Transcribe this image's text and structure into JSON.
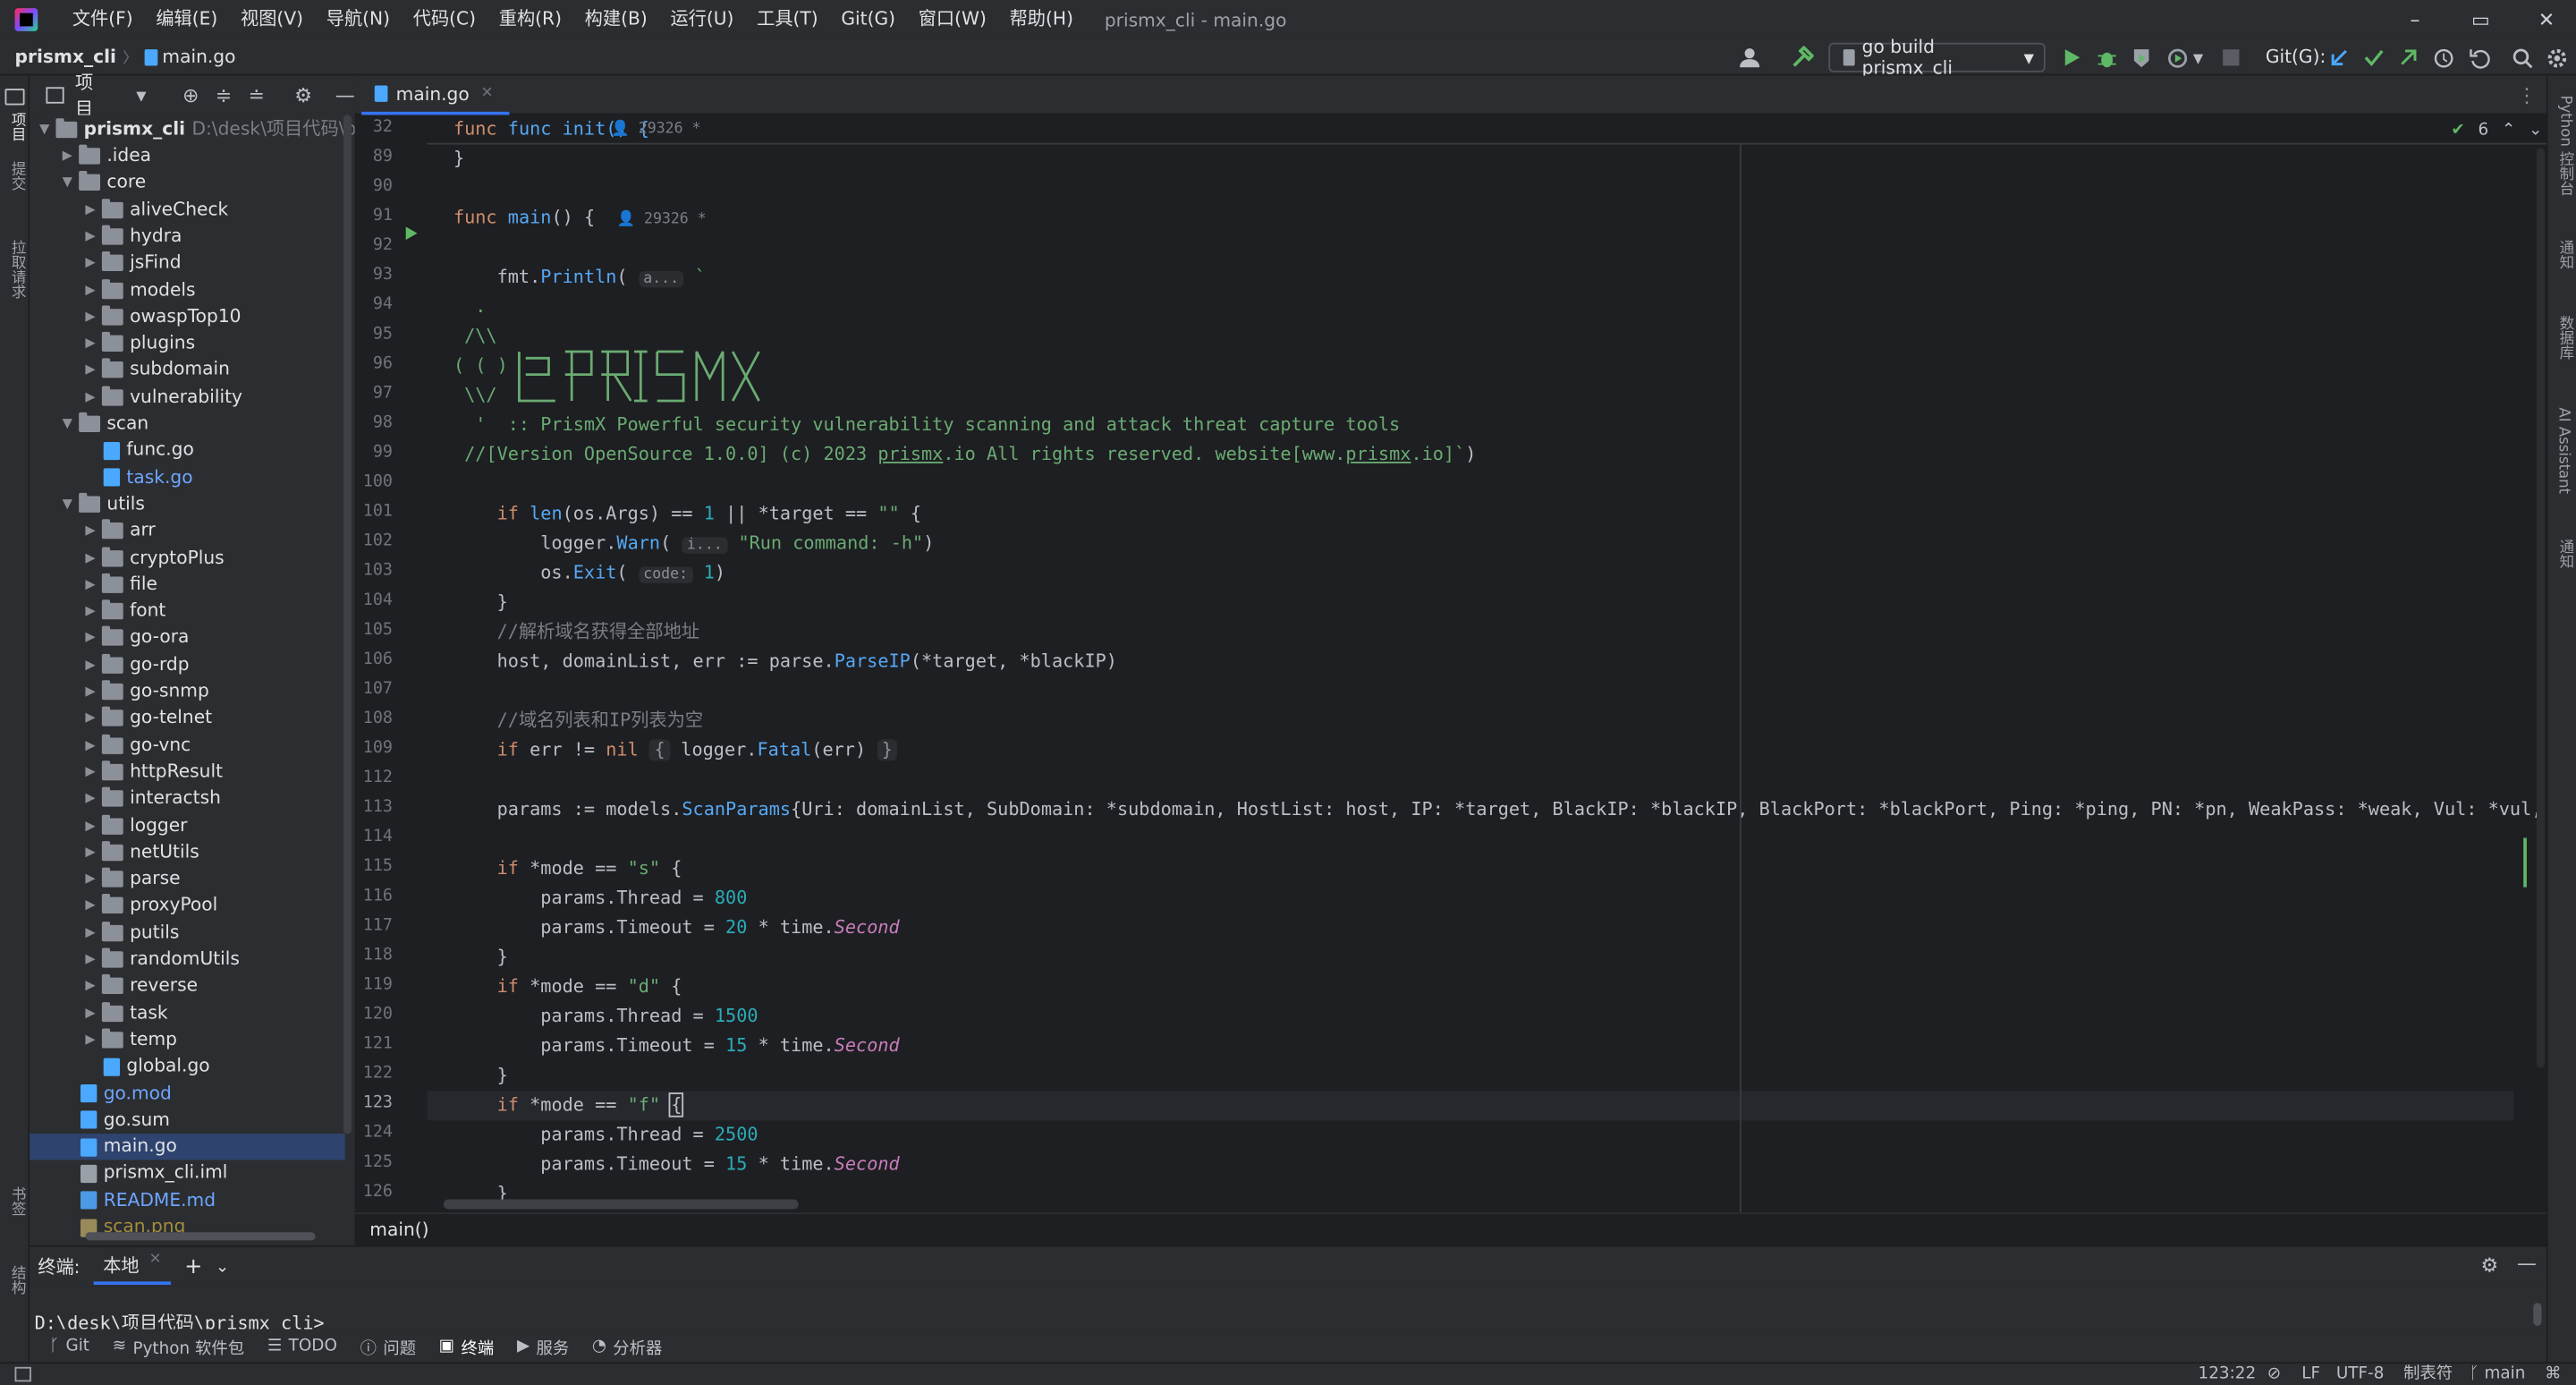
{
  "window": {
    "title": "prismx_cli - main.go",
    "minimize": "–",
    "restore": "▭",
    "close": "✕"
  },
  "menu": [
    "文件(F)",
    "编辑(E)",
    "视图(V)",
    "导航(N)",
    "代码(C)",
    "重构(R)",
    "构建(B)",
    "运行(U)",
    "工具(T)",
    "Git(G)",
    "窗口(W)",
    "帮助(H)"
  ],
  "nav": {
    "project": "prismx_cli",
    "file": "main.go",
    "run_config": "go build prismx_cli",
    "git_label": "Git(G):"
  },
  "left_strip": [
    "项目",
    "提交",
    "拉取请求",
    "书签",
    "结构"
  ],
  "right_strip": [
    "Python 控制台",
    "通知",
    "数据库",
    "AI Assistant",
    "通知"
  ],
  "project_panel": {
    "title": "项目",
    "root_name": "prismx_cli",
    "root_path": "D:\\desk\\项目代码\\prism",
    "tree": [
      {
        "depth": 1,
        "type": "folder",
        "open": false,
        "name": ".idea"
      },
      {
        "depth": 1,
        "type": "folder",
        "open": true,
        "name": "core"
      },
      {
        "depth": 2,
        "type": "folder",
        "open": false,
        "name": "aliveCheck"
      },
      {
        "depth": 2,
        "type": "folder",
        "open": false,
        "name": "hydra"
      },
      {
        "depth": 2,
        "type": "folder",
        "open": false,
        "name": "jsFind"
      },
      {
        "depth": 2,
        "type": "folder",
        "open": false,
        "name": "models"
      },
      {
        "depth": 2,
        "type": "folder",
        "open": false,
        "name": "owaspTop10"
      },
      {
        "depth": 2,
        "type": "folder",
        "open": false,
        "name": "plugins"
      },
      {
        "depth": 2,
        "type": "folder",
        "open": false,
        "name": "subdomain"
      },
      {
        "depth": 2,
        "type": "folder",
        "open": false,
        "name": "vulnerability"
      },
      {
        "depth": 1,
        "type": "folder",
        "open": true,
        "name": "scan"
      },
      {
        "depth": 2,
        "type": "go",
        "name": "func.go"
      },
      {
        "depth": 2,
        "type": "go",
        "name": "task.go",
        "color": "#6ea5ff"
      },
      {
        "depth": 1,
        "type": "folder",
        "open": true,
        "name": "utils"
      },
      {
        "depth": 2,
        "type": "folder",
        "open": false,
        "name": "arr"
      },
      {
        "depth": 2,
        "type": "folder",
        "open": false,
        "name": "cryptoPlus"
      },
      {
        "depth": 2,
        "type": "folder",
        "open": false,
        "name": "file"
      },
      {
        "depth": 2,
        "type": "folder",
        "open": false,
        "name": "font"
      },
      {
        "depth": 2,
        "type": "folder",
        "open": false,
        "name": "go-ora"
      },
      {
        "depth": 2,
        "type": "folder",
        "open": false,
        "name": "go-rdp"
      },
      {
        "depth": 2,
        "type": "folder",
        "open": false,
        "name": "go-snmp"
      },
      {
        "depth": 2,
        "type": "folder",
        "open": false,
        "name": "go-telnet"
      },
      {
        "depth": 2,
        "type": "folder",
        "open": false,
        "name": "go-vnc"
      },
      {
        "depth": 2,
        "type": "folder",
        "open": false,
        "name": "httpResult"
      },
      {
        "depth": 2,
        "type": "folder",
        "open": false,
        "name": "interactsh"
      },
      {
        "depth": 2,
        "type": "folder",
        "open": false,
        "name": "logger"
      },
      {
        "depth": 2,
        "type": "folder",
        "open": false,
        "name": "netUtils"
      },
      {
        "depth": 2,
        "type": "folder",
        "open": false,
        "name": "parse"
      },
      {
        "depth": 2,
        "type": "folder",
        "open": false,
        "name": "proxyPool"
      },
      {
        "depth": 2,
        "type": "folder",
        "open": false,
        "name": "putils"
      },
      {
        "depth": 2,
        "type": "folder",
        "open": false,
        "name": "randomUtils"
      },
      {
        "depth": 2,
        "type": "folder",
        "open": false,
        "name": "reverse"
      },
      {
        "depth": 2,
        "type": "folder",
        "open": false,
        "name": "task"
      },
      {
        "depth": 2,
        "type": "folder",
        "open": false,
        "name": "temp"
      },
      {
        "depth": 2,
        "type": "go",
        "name": "global.go"
      },
      {
        "depth": 1,
        "type": "go",
        "name": "go.mod",
        "color": "#6ea5ff"
      },
      {
        "depth": 1,
        "type": "go",
        "name": "go.sum"
      },
      {
        "depth": 1,
        "type": "go",
        "name": "main.go",
        "selected": true
      },
      {
        "depth": 1,
        "type": "iml",
        "name": "prismx_cli.iml"
      },
      {
        "depth": 1,
        "type": "md",
        "name": "README.md",
        "color": "#6ea5ff"
      },
      {
        "depth": 1,
        "type": "png",
        "name": "scan.png",
        "color": "#a38c3e"
      }
    ]
  },
  "editor": {
    "tab": "main.go",
    "inspection_count": "6",
    "breadcrumb": "main()",
    "sticky_line": "32",
    "sticky_text": "func init() {",
    "sticky_author": "29326 *",
    "lines": [
      {
        "n": "89",
        "html": "<span>}</span>"
      },
      {
        "n": "90",
        "html": ""
      },
      {
        "n": "91",
        "html": "<span class=\"kw\">func</span> <span class=\"fn\">main</span>() {  <span class=\"cm\" style=\"font-size:9px\">👤 29326 *</span>"
      },
      {
        "n": "92",
        "html": ""
      },
      {
        "n": "93",
        "html": "    fmt.<span class=\"fn\">Println</span>( <span class=\"hint\">a...</span> <span class=\"str\">`</span>"
      },
      {
        "n": "94",
        "html": "<span class=\"str\">  .</span>"
      },
      {
        "n": "95",
        "html": "<span class=\"str\"> /\\\\</span>"
      },
      {
        "n": "96",
        "html": "<span class=\"str\">( ( )</span>"
      },
      {
        "n": "97",
        "html": "<span class=\"str\"> \\\\/</span>"
      },
      {
        "n": "98",
        "html": "<span class=\"str\">  '  :: PrismX Powerful security vulnerability scanning and attack threat capture tools</span>"
      },
      {
        "n": "99",
        "html": "<span class=\"str\"> //[Version OpenSource 1.0.0] (c) 2023 <u>prismx</u>.io All rights reserved. website[www.<u>prismx</u>.io]</span><span class=\"str\">`</span>)"
      },
      {
        "n": "100",
        "html": ""
      },
      {
        "n": "101",
        "html": "    <span class=\"kw\">if</span> <span class=\"fn\">len</span>(os.Args) == <span class=\"num\">1</span> || *target == <span class=\"str\">\"\"</span> {"
      },
      {
        "n": "102",
        "html": "        logger.<span class=\"fn\">Warn</span>( <span class=\"hint\">i...</span> <span class=\"str\">\"Run command: -h\"</span>)"
      },
      {
        "n": "103",
        "html": "        os.<span class=\"fn\">Exit</span>( <span class=\"hint\">code:</span> <span class=\"num\">1</span>)"
      },
      {
        "n": "104",
        "html": "    }"
      },
      {
        "n": "105",
        "html": "    <span class=\"cm\">//解析域名获得全部地址</span>"
      },
      {
        "n": "106",
        "html": "    host, domainList, err := parse.<span class=\"fn\">ParseIP</span>(*target, *blackIP)"
      },
      {
        "n": "107",
        "html": ""
      },
      {
        "n": "108",
        "html": "    <span class=\"cm\">//域名列表和IP列表为空</span>"
      },
      {
        "n": "109",
        "html": "    <span class=\"kw\">if</span> err != <span class=\"kw\">nil</span> <span class=\"hint\" style=\"font-size:11px\">{</span> logger.<span class=\"fn\">Fatal</span>(err) <span class=\"hint\" style=\"font-size:11px\">}</span>"
      },
      {
        "n": "112",
        "html": ""
      },
      {
        "n": "113",
        "html": "    params := models.<span class=\"fn\">ScanParams</span>{Uri: domainList, SubDomain: *subdomain, HostList: host, IP: *target, BlackIP: *blackIP, BlackPort: *blackPort, Ping: *ping, PN: *pn, WeakPass: *weak, Vul: *vul, Po"
      },
      {
        "n": "114",
        "html": ""
      },
      {
        "n": "115",
        "html": "    <span class=\"kw\">if</span> *mode == <span class=\"str\">\"s\"</span> {"
      },
      {
        "n": "116",
        "html": "        params.Thread = <span class=\"num\">800</span>"
      },
      {
        "n": "117",
        "html": "        params.Timeout = <span class=\"num\">20</span> * time.<span class=\"it\">Second</span>"
      },
      {
        "n": "118",
        "html": "    }"
      },
      {
        "n": "119",
        "html": "    <span class=\"kw\">if</span> *mode == <span class=\"str\">\"d\"</span> {"
      },
      {
        "n": "120",
        "html": "        params.Thread = <span class=\"num\">1500</span>"
      },
      {
        "n": "121",
        "html": "        params.Timeout = <span class=\"num\">15</span> * time.<span class=\"it\">Second</span>"
      },
      {
        "n": "122",
        "html": "    }"
      },
      {
        "n": "123",
        "html": "    <span class=\"kw\">if</span> *mode == <span class=\"str\">\"f\"</span> <span style=\"outline:1px solid #bcbec4\">{</span>"
      },
      {
        "n": "124",
        "html": "        params.Thread = <span class=\"num\">2500</span>"
      },
      {
        "n": "125",
        "html": "        params.Timeout = <span class=\"num\">15</span> * time.<span class=\"it\">Second</span>"
      },
      {
        "n": "126",
        "html": "    }"
      }
    ],
    "banner_text": "PRISMX"
  },
  "terminal": {
    "label": "终端:",
    "tab": "本地",
    "prompt": "D:\\desk\\项目代码\\prismx_cli>"
  },
  "tool_tabs": [
    "Git",
    "Python 软件包",
    "TODO",
    "问题",
    "终端",
    "服务",
    "分析器"
  ],
  "status": {
    "position": "123:22",
    "line_sep": "LF",
    "encoding": "UTF-8",
    "indent": "制表符",
    "branch": "main"
  },
  "colors": {
    "accent": "#3574f0",
    "selection": "#2e436e",
    "keyword": "#cf8e6d",
    "function": "#56a8f5",
    "string": "#6aab73",
    "number": "#2aacb8"
  }
}
